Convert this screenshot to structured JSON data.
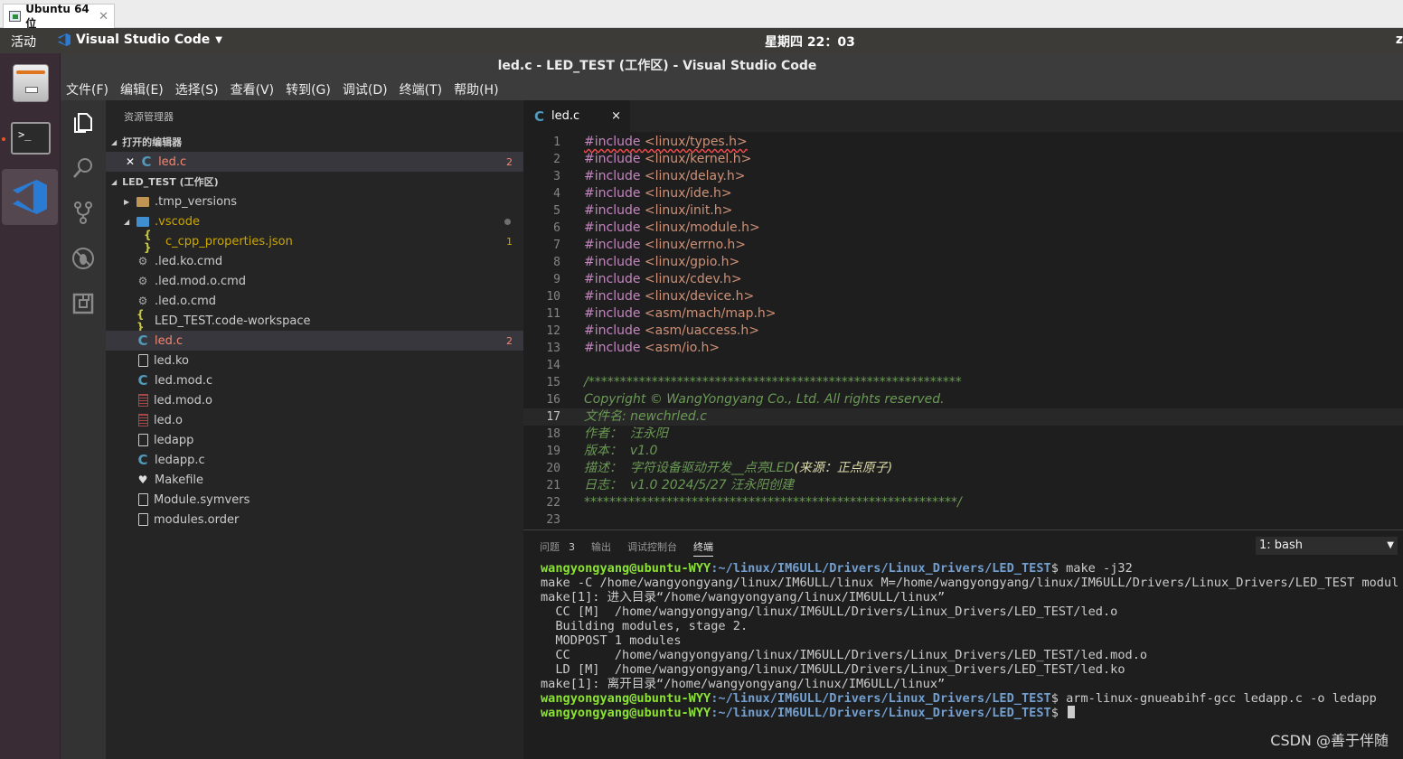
{
  "vm": {
    "tab_title": "Ubuntu 64 位",
    "close": "✕"
  },
  "panel": {
    "activities": "活动",
    "app_name": "Visual Studio Code",
    "clock": "星期四 22：03",
    "right_clip": "z"
  },
  "window": {
    "title": "led.c - LED_TEST (工作区) - Visual Studio Code"
  },
  "menubar": [
    "文件(F)",
    "编辑(E)",
    "选择(S)",
    "查看(V)",
    "转到(G)",
    "调试(D)",
    "终端(T)",
    "帮助(H)"
  ],
  "sidebar": {
    "title": "资源管理器",
    "open_editors_header": "打开的编辑器",
    "open_editors": [
      {
        "name": "led.c",
        "badge": "2"
      }
    ],
    "workspace_header": "LED_TEST (工作区)",
    "tree": [
      {
        "name": ".tmp_versions",
        "icon": "folder-icon"
      },
      {
        "name": ".vscode",
        "icon": "vscode-folder-icon"
      },
      {
        "name": "c_cpp_properties.json",
        "icon": "json-icon",
        "badge": "1"
      },
      {
        "name": ".led.ko.cmd",
        "icon": "gear-icon"
      },
      {
        "name": ".led.mod.o.cmd",
        "icon": "gear-icon"
      },
      {
        "name": ".led.o.cmd",
        "icon": "gear-icon"
      },
      {
        "name": "LED_TEST.code-workspace",
        "icon": "json-icon"
      },
      {
        "name": "led.c",
        "icon": "c-file-icon",
        "badge": "2"
      },
      {
        "name": "led.ko",
        "icon": "file-icon"
      },
      {
        "name": "led.mod.c",
        "icon": "c-file-icon"
      },
      {
        "name": "led.mod.o",
        "icon": "binary-file-icon"
      },
      {
        "name": "led.o",
        "icon": "binary-file-icon"
      },
      {
        "name": "ledapp",
        "icon": "file-icon"
      },
      {
        "name": "ledapp.c",
        "icon": "c-file-icon"
      },
      {
        "name": "Makefile",
        "icon": "makefile-icon"
      },
      {
        "name": "Module.symvers",
        "icon": "file-icon"
      },
      {
        "name": "modules.order",
        "icon": "file-icon"
      }
    ]
  },
  "editor": {
    "tab_label": "led.c",
    "tab_close": "×",
    "current_line": 17,
    "lines": [
      {
        "n": "1",
        "kw": "#include",
        "rest": " <linux/types.h>"
      },
      {
        "n": "2",
        "kw": "#include",
        "rest": " <linux/kernel.h>"
      },
      {
        "n": "3",
        "kw": "#include",
        "rest": " <linux/delay.h>"
      },
      {
        "n": "4",
        "kw": "#include",
        "rest": " <linux/ide.h>"
      },
      {
        "n": "5",
        "kw": "#include",
        "rest": " <linux/init.h>"
      },
      {
        "n": "6",
        "kw": "#include",
        "rest": " <linux/module.h>"
      },
      {
        "n": "7",
        "kw": "#include",
        "rest": " <linux/errno.h>"
      },
      {
        "n": "8",
        "kw": "#include",
        "rest": " <linux/gpio.h>"
      },
      {
        "n": "9",
        "kw": "#include",
        "rest": " <linux/cdev.h>"
      },
      {
        "n": "10",
        "kw": "#include",
        "rest": " <linux/device.h>"
      },
      {
        "n": "11",
        "kw": "#include",
        "rest": " <asm/mach/map.h>"
      },
      {
        "n": "12",
        "kw": "#include",
        "rest": " <asm/uaccess.h>"
      },
      {
        "n": "13",
        "kw": "#include",
        "rest": " <asm/io.h>"
      },
      {
        "n": "14",
        "kw": "",
        "rest": ""
      },
      {
        "n": "15",
        "cmt": "/***********************************************************"
      },
      {
        "n": "16",
        "cmt": "Copyright © WangYongyang Co., Ltd. All rights reserved."
      },
      {
        "n": "17",
        "cmt": "文件名: newchrled.c"
      },
      {
        "n": "18",
        "cmt": "作者：  汪永阳"
      },
      {
        "n": "19",
        "cmt": "版本：  v1.0"
      },
      {
        "n": "20",
        "cmt": "描述：  字符设备驱动开发__点亮LED",
        "cmt2": "(来源：正点原子)"
      },
      {
        "n": "21",
        "cmt": "日志：  v1.0 2024/5/27 汪永阳创建"
      },
      {
        "n": "22",
        "cmt": "***********************************************************/"
      },
      {
        "n": "23",
        "kw": "",
        "rest": ""
      }
    ]
  },
  "bottom_panel": {
    "tabs": [
      {
        "label": "问题",
        "count": "3"
      },
      {
        "label": "输出"
      },
      {
        "label": "调试控制台"
      },
      {
        "label": "终端"
      }
    ],
    "terminal_select": "1: bash",
    "terminal_lines": [
      {
        "user": "wangyongyang@ubuntu-WYY",
        "path": ":~/linux/IM6ULL/Drivers/Linux_Drivers/LED_TEST",
        "cmd": "$ make -j32"
      },
      {
        "text": "make -C /home/wangyongyang/linux/IM6ULL/linux M=/home/wangyongyang/linux/IM6ULL/Drivers/Linux_Drivers/LED_TEST modules"
      },
      {
        "text": "make[1]: 进入目录“/home/wangyongyang/linux/IM6ULL/linux”"
      },
      {
        "text": "  CC [M]  /home/wangyongyang/linux/IM6ULL/Drivers/Linux_Drivers/LED_TEST/led.o"
      },
      {
        "text": "  Building modules, stage 2."
      },
      {
        "text": "  MODPOST 1 modules"
      },
      {
        "text": "  CC      /home/wangyongyang/linux/IM6ULL/Drivers/Linux_Drivers/LED_TEST/led.mod.o"
      },
      {
        "text": "  LD [M]  /home/wangyongyang/linux/IM6ULL/Drivers/Linux_Drivers/LED_TEST/led.ko"
      },
      {
        "text": "make[1]: 离开目录“/home/wangyongyang/linux/IM6ULL/linux”"
      },
      {
        "user": "wangyongyang@ubuntu-WYY",
        "path": ":~/linux/IM6ULL/Drivers/Linux_Drivers/LED_TEST",
        "cmd": "$ arm-linux-gnueabihf-gcc ledapp.c -o ledapp"
      },
      {
        "user": "wangyongyang@ubuntu-WYY",
        "path": ":~/linux/IM6ULL/Drivers/Linux_Drivers/LED_TEST",
        "cmd": "$ ",
        "cursor": true
      }
    ]
  },
  "watermark": "CSDN @善于伴随",
  "colors": {
    "accent": "#e95420",
    "keyword": "#c586c0",
    "string": "#ce9178",
    "comment": "#6a9955",
    "error": "#f48771",
    "warning": "#cca700",
    "term_user": "#8ae234",
    "term_path": "#729fcf"
  }
}
